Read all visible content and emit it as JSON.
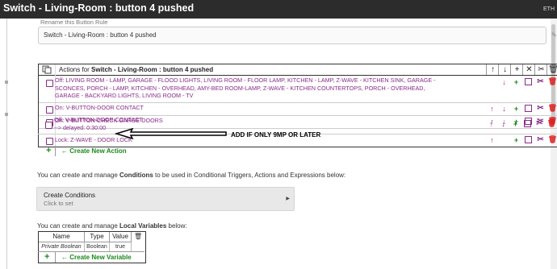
{
  "window": {
    "title": "Switch - Living-Room : button 4 pushed",
    "right_label": "ETH"
  },
  "rename": {
    "label": "Rename this Button Rule",
    "value": "Switch - Living-Room : button 4 pushed",
    "edit_icon": "pencil-icon"
  },
  "actions_table": {
    "header_prefix": "Actions for ",
    "header_name": "Switch - Living-Room : button 4 pushed",
    "header_icons": [
      "arrow-up-icon",
      "arrow-down-icon",
      "plus-icon",
      "close-icon",
      "scissors-icon",
      "trash-icon"
    ],
    "rows": [
      {
        "text": "Off: LIVING ROOM - LAMP, GARAGE - FLOOD LIGHTS, LIVING ROOM - FLOOR LAMP, KITCHEN - LAMP, Z-WAVE - KITCHEN SINK, GARAGE - SCONCES, PORCH - LAMP, KITCHEN - OVERHEAD, AMY-BED ROOM-LAMP, Z-WAVE - KITCHEN COUNTERTOPS, PORCH - OVERHEAD, GARAGE - BACKYARD LIGHTS, LIVING ROOM - TV",
        "delay": ""
      },
      {
        "text": "On: V-BUTTON-DOOR CONTACT",
        "delay": ""
      },
      {
        "text": "On: V-BUTTON-CHECK GARGE DOORS",
        "delay": ""
      },
      {
        "text": "Off: V-BUTTON-DOOR CONTACT",
        "delay": "--> delayed: 0:30:00"
      },
      {
        "text": "Lock: Z-WAVE - DOOR LOCK",
        "delay": ""
      }
    ],
    "new_action_label": "← Create New Action"
  },
  "annotation": "ADD IF ONLY 9MP OR LATER",
  "conditions": {
    "info_prefix": "You can create and manage ",
    "info_bold": "Conditions",
    "info_suffix": " to be used in Conditional Triggers, Actions and Expressions below:",
    "button_title": "Create Conditions",
    "button_sub": "Click to set"
  },
  "variables": {
    "info_prefix": "You can create and manage ",
    "info_bold": "Local Variables",
    "info_suffix": " below:",
    "headers": [
      "Name",
      "Type",
      "Value"
    ],
    "row": [
      "Private Boolean",
      "Boolean",
      "true"
    ],
    "new_label": "← Create New Variable"
  },
  "colors": {
    "accent": "#8a2a8a",
    "green": "#1a8a1a",
    "delete": "#dd2222"
  }
}
